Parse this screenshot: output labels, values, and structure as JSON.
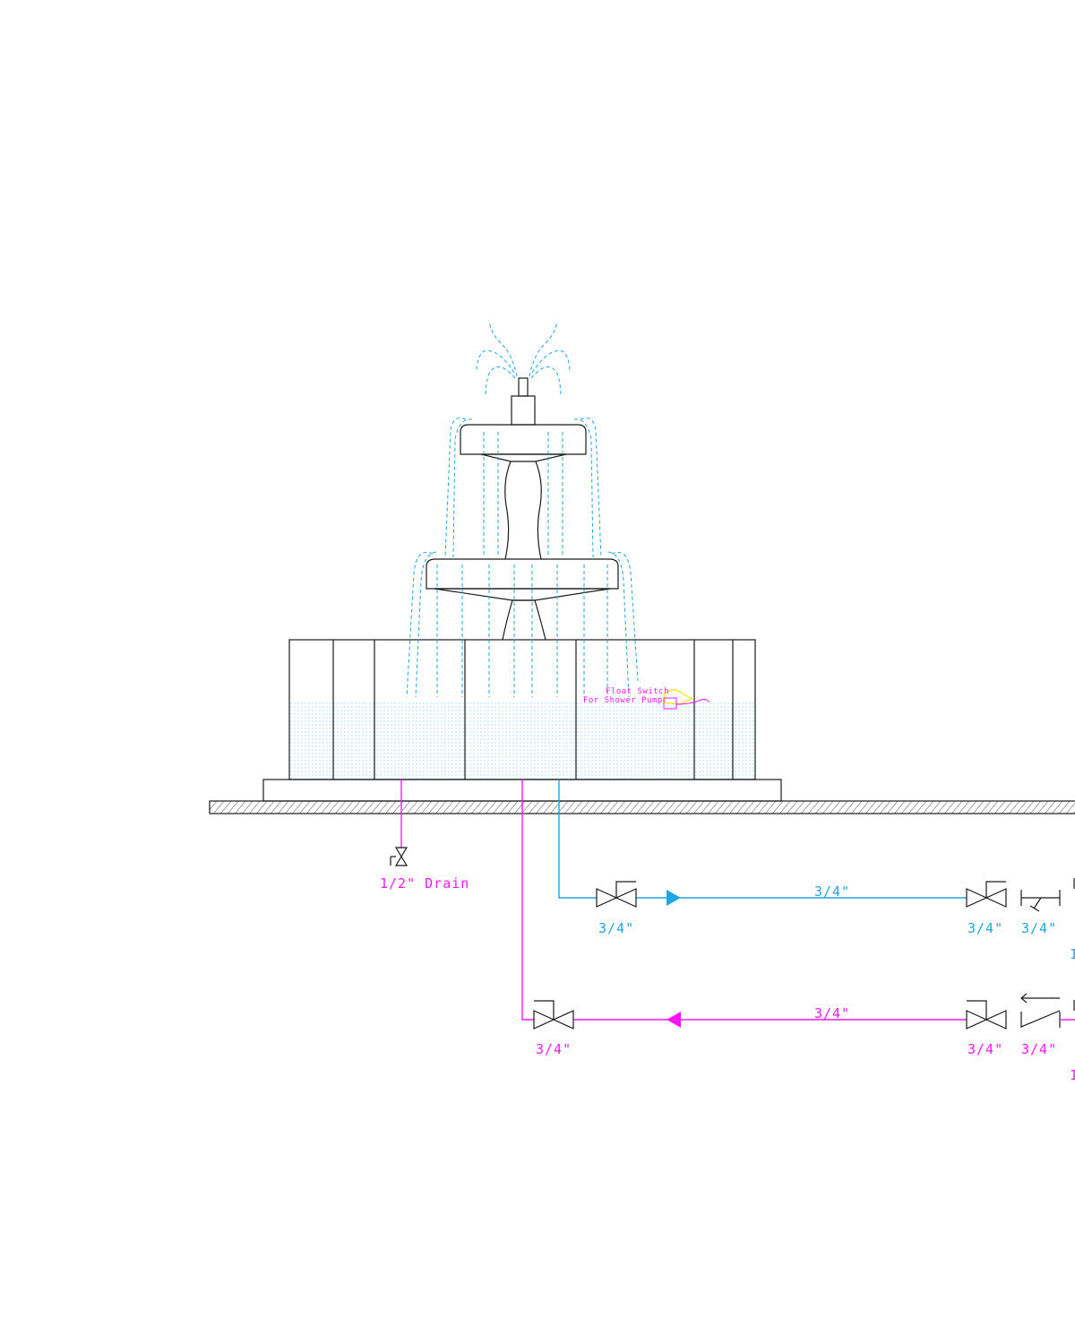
{
  "colors": {
    "outline": "#1a1a1a",
    "supply": "#1fa6e0",
    "return": "#ff16ff",
    "float_switch": "#f2e600"
  },
  "labels": {
    "drain": "1/2\" Drain",
    "float_switch_line1": "Float Switch",
    "float_switch_line2": "For Shower Pump",
    "supply_valve_1": "3/4\"",
    "supply_run": "3/4\"",
    "supply_valve_2": "3/4\"",
    "supply_valve_3": "3/4\"",
    "return_valve_1": "3/4\"",
    "return_run": "3/4\"",
    "return_valve_2": "3/4\"",
    "return_valve_3": "3/4\"",
    "edge_mark_supply": "1",
    "edge_mark_return": "1"
  },
  "icons": [
    "gate-valve-icon",
    "check-valve-icon",
    "y-strainer-icon",
    "flow-arrow-icon",
    "float-switch-icon"
  ]
}
